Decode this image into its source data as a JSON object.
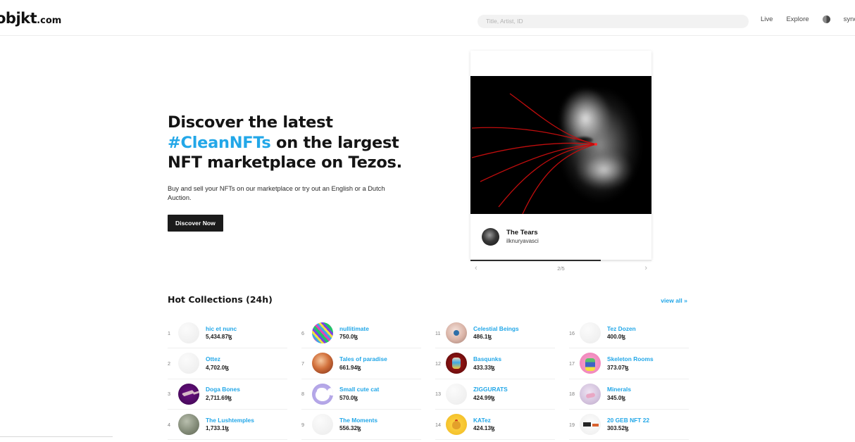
{
  "header": {
    "brand_name": "objkt",
    "brand_suffix": ".com",
    "search_placeholder": "Title, Artist, ID",
    "search_value": "",
    "nav": [
      {
        "label": "Live"
      },
      {
        "label": "Explore"
      },
      {
        "label": "sync"
      }
    ],
    "theme_toggle_icon": "half-circle-icon"
  },
  "hero": {
    "title_part1": "Discover the latest ",
    "title_highlight": "#CleanNFTs",
    "title_part2": " on the largest NFT marketplace on Tezos.",
    "subtitle": "Buy and sell your NFTs on our marketplace or try out an English or a Dutch Auction.",
    "cta_label": "Discover Now"
  },
  "feature": {
    "title": "The Tears",
    "artist": "ilknuryavasci",
    "counter": "2/5",
    "progress_percent": 72,
    "prev_icon": "chevron-left-icon",
    "next_icon": "chevron-right-icon",
    "artwork_alt": "dark portrait with red streaming lines"
  },
  "collections": {
    "section_title": "Hot Collections (24h)",
    "view_all_label": "view all »",
    "currency_symbol": "ꜩ",
    "columns": [
      {
        "items": [
          {
            "rank": "1",
            "name": "hic et nunc",
            "volume": "5,434.87ꜩ",
            "thumb": "t-blank"
          },
          {
            "rank": "2",
            "name": "Ottez",
            "volume": "4,702.0ꜩ",
            "thumb": "t-blank"
          },
          {
            "rank": "3",
            "name": "Doga Bones",
            "volume": "2,711.69ꜩ",
            "thumb": "t-doga"
          },
          {
            "rank": "4",
            "name": "The Lushtemples",
            "volume": "1,733.1ꜩ",
            "thumb": "t-lush"
          }
        ]
      },
      {
        "items": [
          {
            "rank": "6",
            "name": "nullitimate",
            "volume": "750.0ꜩ",
            "thumb": "t-null"
          },
          {
            "rank": "7",
            "name": "Tales of paradise",
            "volume": "661.94ꜩ",
            "thumb": "t-tales"
          },
          {
            "rank": "8",
            "name": "Small cute cat",
            "volume": "570.0ꜩ",
            "thumb": "t-cat"
          },
          {
            "rank": "9",
            "name": "The Moments",
            "volume": "556.32ꜩ",
            "thumb": "t-blank"
          }
        ]
      },
      {
        "items": [
          {
            "rank": "11",
            "name": "Celestial Beings",
            "volume": "486.1ꜩ",
            "thumb": "t-celest"
          },
          {
            "rank": "12",
            "name": "Basqunks",
            "volume": "433.33ꜩ",
            "thumb": "t-basq"
          },
          {
            "rank": "13",
            "name": "ZIGGURATS",
            "volume": "424.99ꜩ",
            "thumb": "t-blank"
          },
          {
            "rank": "14",
            "name": "KATez",
            "volume": "424.13ꜩ",
            "thumb": "t-katez"
          }
        ]
      },
      {
        "items": [
          {
            "rank": "16",
            "name": "Tez Dozen",
            "volume": "400.0ꜩ",
            "thumb": "t-blank"
          },
          {
            "rank": "17",
            "name": "Skeleton Rooms",
            "volume": "373.07ꜩ",
            "thumb": "t-skel"
          },
          {
            "rank": "18",
            "name": "Minerals",
            "volume": "345.0ꜩ",
            "thumb": "t-miner"
          },
          {
            "rank": "19",
            "name": "20 GEB NFT 22",
            "volume": "303.52ꜩ",
            "thumb": "t-geb"
          }
        ]
      }
    ]
  },
  "colors": {
    "accent_blue": "#22a7e8",
    "button_black": "#1b1b1b",
    "text_dark": "#141414"
  }
}
